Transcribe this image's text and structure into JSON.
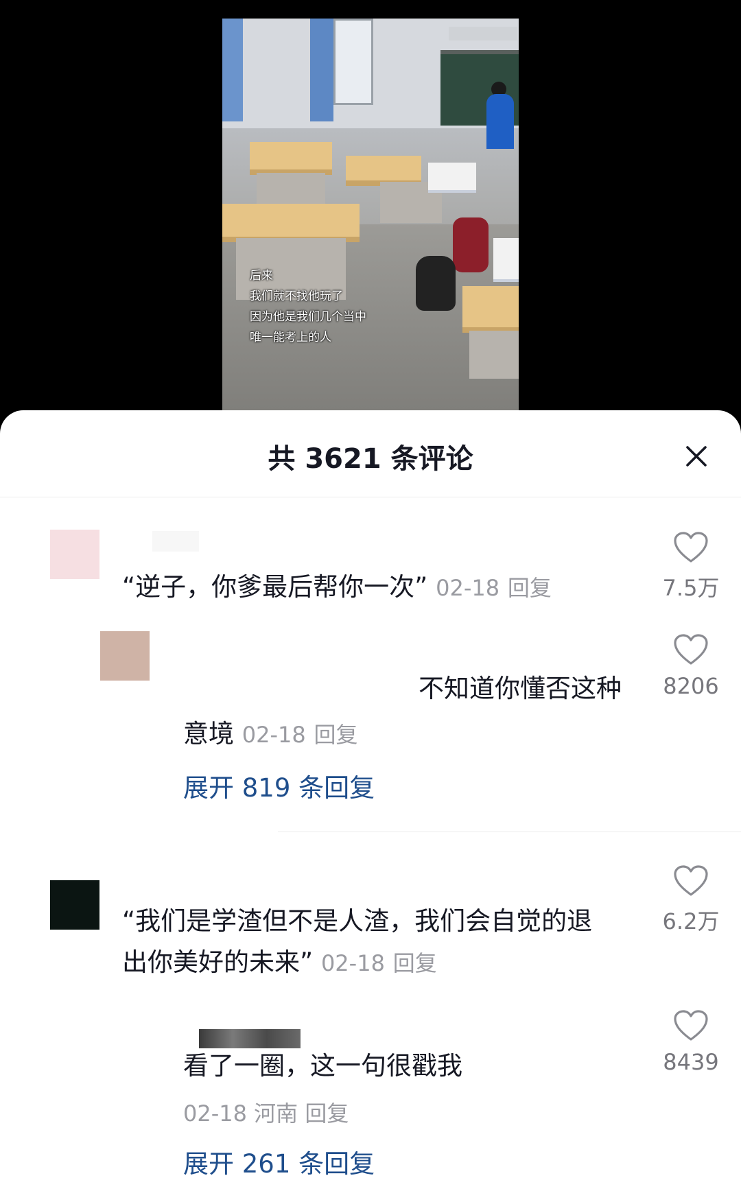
{
  "video": {
    "subtitles": [
      "后来",
      "我们就不找他玩了",
      "因为他是我们几个当中",
      "唯一能考上的人"
    ]
  },
  "panel": {
    "title": "共 3621 条评论",
    "close_icon": "close-icon"
  },
  "comments": [
    {
      "text": "“逆子，你爹最后帮你一次”",
      "date": "02-18",
      "reply_label": "回复",
      "likes": "7.5万",
      "avatar_color": "#f6dfe2"
    },
    {
      "text_line1": "不知道你懂否这种",
      "text_line2": "意境",
      "date": "02-18",
      "reply_label": "回复",
      "likes": "8206",
      "avatar_color": "#cfb3a6",
      "expand_label": "展开 819 条回复"
    },
    {
      "text_line1": "“我们是学渣但不是人渣，我们会自觉的退",
      "text_line2": "出你美好的未来”",
      "date": "02-18",
      "reply_label": "回复",
      "likes": "6.2万",
      "avatar_color": "#0b1512"
    },
    {
      "text": "看了一圈，这一句很戳我",
      "date": "02-18",
      "location": "河南",
      "reply_label": "回复",
      "likes": "8439",
      "expand_label": "展开 261 条回复"
    }
  ],
  "colors": {
    "link_blue": "#1f4e8c",
    "meta_gray": "#9a9ba1",
    "text_dark": "#161823"
  }
}
